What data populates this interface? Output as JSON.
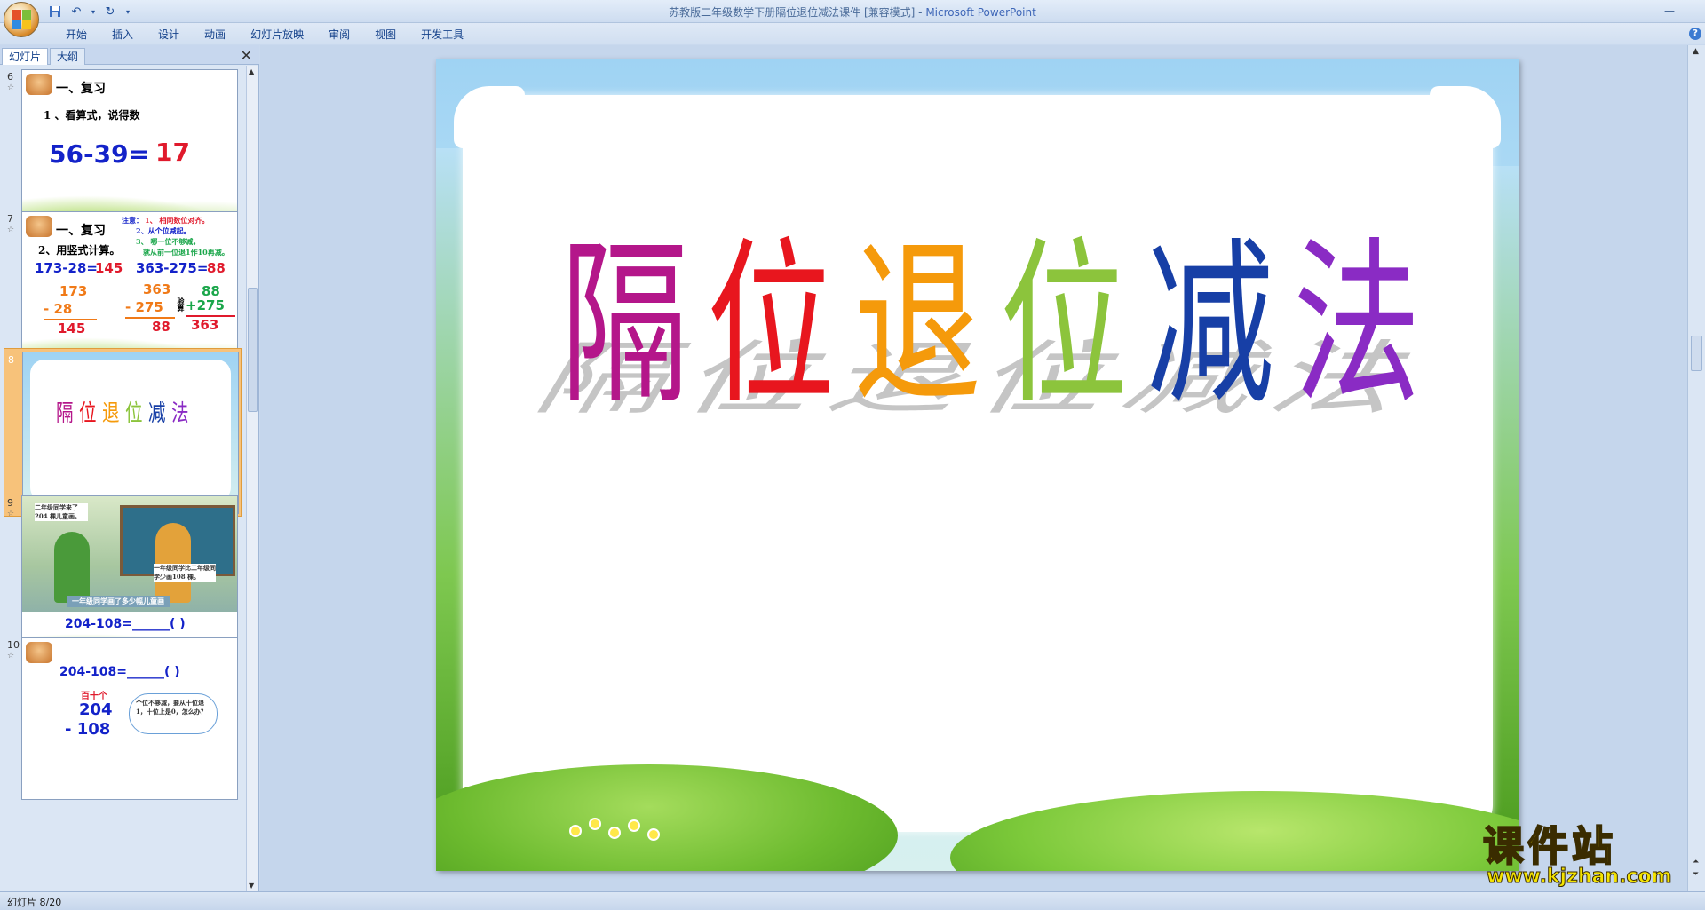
{
  "window": {
    "doc_title": "苏教版二年级数学下册隔位退位减法课件 [兼容模式]",
    "separator": " - ",
    "app_name": "Microsoft PowerPoint"
  },
  "quick_access": {
    "save_icon": "save-icon",
    "undo_icon": "undo-icon",
    "redo_icon": "redo-icon",
    "customize_icon": "dropdown-icon"
  },
  "ribbon": {
    "tabs": [
      "开始",
      "插入",
      "设计",
      "动画",
      "幻灯片放映",
      "审阅",
      "视图",
      "开发工具"
    ],
    "help": "?"
  },
  "left_pane": {
    "tab_slides": "幻灯片",
    "tab_outline": "大纲",
    "close": "✕"
  },
  "thumbnails": [
    {
      "number": "6",
      "heading": "一、复习",
      "subheading": "1 、看算式，说得数",
      "equation": "56-39=",
      "answer": "17"
    },
    {
      "number": "7",
      "heading": "一、复习",
      "subheading": "2、用竖式计算。",
      "notes": [
        "注意：",
        "1、 相同数位对齐。",
        "2、从个位减起。",
        "3、 哪一位不够减，",
        "就从前一位退1作10再减。"
      ],
      "eq1": "173-28=",
      "ans1": "145",
      "eq2": "363-275=",
      "ans2": "88",
      "col1": [
        "173",
        "-  28",
        "145"
      ],
      "col2": [
        "363",
        "-  275",
        "88"
      ],
      "check_label": "验算",
      "col3": [
        "88",
        "+275",
        "363"
      ]
    },
    {
      "number": "8",
      "title_chars": [
        "隔",
        "位",
        "退",
        "位",
        "减",
        "法"
      ]
    },
    {
      "number": "9",
      "bubble1": "二年级同学来了204 棵儿童画。",
      "bubble2": "一年级同学比二年级同学少画108 棵。",
      "banner": "一年级同学画了多少幅儿童画",
      "equation": "204-108=______(    )"
    },
    {
      "number": "10",
      "equation": "204-108=______(    )",
      "place_labels": "百十个",
      "top": "204",
      "bottom": "- 108",
      "cloud": "个位不够减，要从十位退1，十位上是0，怎么办？"
    }
  ],
  "main_slide": {
    "title_chars": [
      "隔",
      "位",
      "退",
      "位",
      "减",
      "法"
    ],
    "colors": [
      "#b4168a",
      "#e8161e",
      "#f59a0b",
      "#8cc43c",
      "#173fa6",
      "#8a2bc4"
    ]
  },
  "watermark": {
    "text": "课件站",
    "url": "www.kjzhan.com"
  },
  "status": {
    "slide_info": "幻灯片 8/20"
  }
}
